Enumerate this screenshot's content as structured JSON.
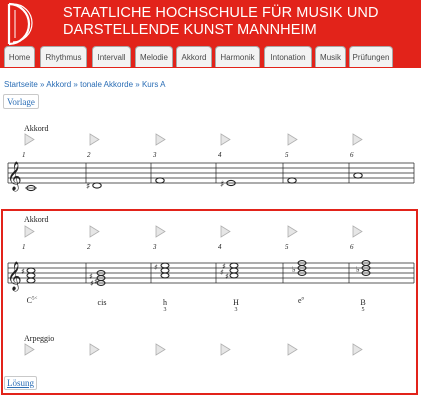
{
  "header": {
    "title_line1": "STAATLICHE HOCHSCHULE FÜR MUSIK UND",
    "title_line2": "DARSTELLENDE KUNST MANNHEIM",
    "bg_color": "#e2231a"
  },
  "nav": {
    "tabs": [
      {
        "label": "Home"
      },
      {
        "label": "Rhythmus"
      },
      {
        "label": "Intervall"
      },
      {
        "label": "Melodie"
      },
      {
        "label": "Akkord"
      },
      {
        "label": "Harmonik"
      },
      {
        "label": "Intonation"
      },
      {
        "label": "Musik"
      },
      {
        "label": "Prüfungen"
      }
    ]
  },
  "breadcrumb": {
    "items": [
      "Startseite",
      "Akkord",
      "tonale Akkorde",
      "Kurs A"
    ],
    "separator": "»"
  },
  "vorlage_label": "Vorlage",
  "example": {
    "label": "Akkord",
    "numbers": [
      "1",
      "2",
      "3",
      "4",
      "5",
      "6"
    ]
  },
  "exercise": {
    "label": "Akkord",
    "numbers": [
      "1",
      "2",
      "3",
      "4",
      "5",
      "6"
    ],
    "chords": [
      {
        "name": "C",
        "sup": "5<",
        "sub": ""
      },
      {
        "name": "cis",
        "sup": "",
        "sub": ""
      },
      {
        "name": "h",
        "sup": "",
        "sub": "3"
      },
      {
        "name": "H",
        "sup": "",
        "sub": "3"
      },
      {
        "name": "e",
        "sup": "o",
        "sub": ""
      },
      {
        "name": "B",
        "sup": "",
        "sub": "5"
      }
    ],
    "arpeggio_label": "Arpeggio",
    "border_color": "#e2231a"
  },
  "loesung_label": "Lösung",
  "icons": {
    "play": "play-triangle-icon",
    "clef": "treble-clef-icon"
  }
}
